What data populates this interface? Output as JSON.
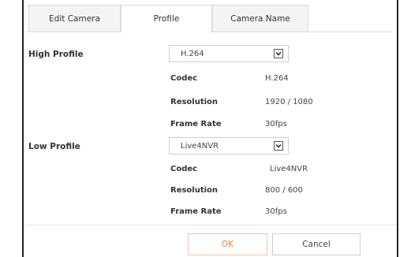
{
  "tabs": [
    {
      "label": "Edit Camera",
      "active": false
    },
    {
      "label": "Profile",
      "active": true
    },
    {
      "label": "Camera Name",
      "active": false
    }
  ],
  "high_profile": {
    "title": "High Profile",
    "selected": "H.264",
    "fields": [
      {
        "label": "Codec",
        "value": "H.264"
      },
      {
        "label": "Resolution",
        "value": "1920 / 1080"
      },
      {
        "label": "Frame Rate",
        "value": "30fps"
      }
    ]
  },
  "low_profile": {
    "title": "Low Profile",
    "selected": "Live4NVR",
    "fields": [
      {
        "label": "Codec",
        "value": "Live4NVR"
      },
      {
        "label": "Resolution",
        "value": "800 / 600"
      },
      {
        "label": "Frame Rate",
        "value": "30fps"
      }
    ]
  },
  "buttons": {
    "ok_label": "OK",
    "cancel_label": "Cancel"
  },
  "colors": {
    "ok_text": "#ef8a3b",
    "ok_border": "#f3c7a5",
    "border": "#dcdcdc"
  },
  "icons": {
    "dropdown": "chevron-down-icon"
  }
}
